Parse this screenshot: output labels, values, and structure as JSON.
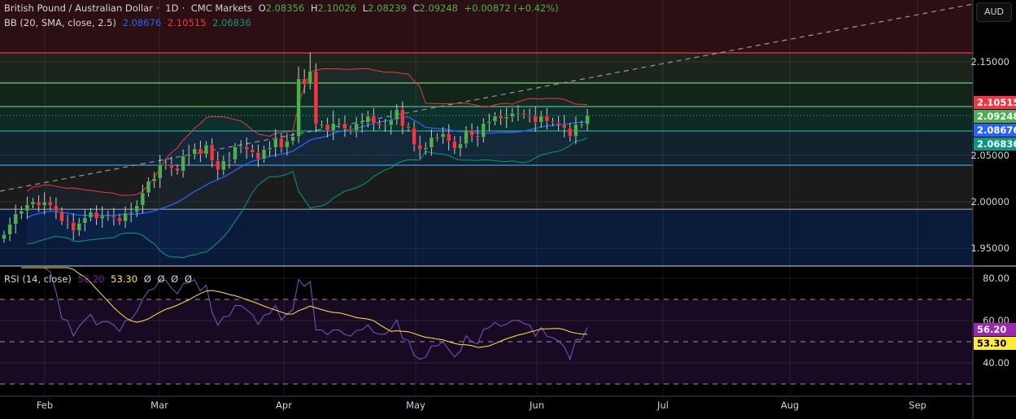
{
  "header": {
    "symbol": "British Pound / Australian Dollar",
    "interval": "1D",
    "source": "CMC Markets",
    "sep": "·",
    "o_label": "O",
    "o": "2.08356",
    "h_label": "H",
    "h": "2.10026",
    "l_label": "L",
    "l": "2.08239",
    "c_label": "C",
    "c": "2.09248",
    "change": "+0.00872 (+0.42%)"
  },
  "bb_legend": {
    "label": "BB (20, SMA, close, 2.5)",
    "basis": "2.08676",
    "upper": "2.10515",
    "lower": "2.06836"
  },
  "rsi_legend": {
    "label": "RSI (14, close)",
    "rsi": "56.20",
    "ma": "53.30",
    "extra": [
      "Ø",
      "Ø",
      "Ø",
      "Ø"
    ]
  },
  "currency": "AUD",
  "price_axis": [
    "2.15000",
    "2.05000",
    "2.00000",
    "1.95000"
  ],
  "price_tags": [
    {
      "text": "2.10515",
      "color": "#f23645"
    },
    {
      "text": "2.09248",
      "color": "#4caf50"
    },
    {
      "text": "2.08676",
      "color": "#2962ff"
    },
    {
      "text": "2.06836",
      "color": "#089981"
    }
  ],
  "rsi_axis": [
    "80.00",
    "60.00",
    "40.00"
  ],
  "rsi_tags": [
    {
      "text": "56.20",
      "color": "#9c27b0",
      "fg": "#fff"
    },
    {
      "text": "53.30",
      "color": "#ffeb3b",
      "fg": "#000"
    }
  ],
  "time_axis": [
    "Feb",
    "Mar",
    "Apr",
    "May",
    "Jun",
    "Jul",
    "Aug",
    "Sep"
  ],
  "chart_data": {
    "type": "candlestick",
    "title": "British Pound / Australian Dollar · 1D · CMC Markets",
    "ylim": [
      1.925,
      2.195
    ],
    "levels": [
      2.1596,
      2.1273,
      2.102,
      2.0759,
      2.0392,
      1.992
    ],
    "closes": [
      1.965,
      1.976,
      1.987,
      1.99,
      1.997,
      2.0,
      1.996,
      2.0,
      1.996,
      1.99,
      1.979,
      1.978,
      1.969,
      1.977,
      1.983,
      1.989,
      1.982,
      1.985,
      1.985,
      1.983,
      1.979,
      1.988,
      1.989,
      1.996,
      2.0096,
      2.022,
      2.025,
      2.04,
      2.04,
      2.036,
      2.033,
      2.049,
      2.051,
      2.057,
      2.051,
      2.061,
      2.044,
      2.034,
      2.044,
      2.045,
      2.059,
      2.059,
      2.056,
      2.053,
      2.046,
      2.056,
      2.058,
      2.068,
      2.058,
      2.065,
      2.07,
      2.132,
      2.126,
      2.14,
      2.083,
      2.083,
      2.076,
      2.084,
      2.084,
      2.078,
      2.076,
      2.084,
      2.085,
      2.092,
      2.084,
      2.082,
      2.082,
      2.088,
      2.099,
      2.081,
      2.079,
      2.061,
      2.056,
      2.058,
      2.069,
      2.069,
      2.073,
      2.065,
      2.057,
      2.062,
      2.077,
      2.071,
      2.069,
      2.084,
      2.086,
      2.092,
      2.089,
      2.091,
      2.095,
      2.095,
      2.093,
      2.092,
      2.085,
      2.092,
      2.086,
      2.085,
      2.083,
      2.079,
      2.07,
      2.083,
      2.083,
      2.09248
    ],
    "first_open": 1.96,
    "bb": {
      "length": 20,
      "mult": 2.5
    },
    "rsi": {
      "length": 14,
      "ma_length": 14,
      "ylim": [
        25,
        85
      ],
      "levels": [
        70,
        50,
        30
      ]
    },
    "colors": {
      "up": "#4caf50",
      "down": "#f23645",
      "basis": "#2962ff",
      "upper": "#f23645",
      "lower": "#089981",
      "rsi": "#7e57c2",
      "rsi_ma": "#ffeb3b"
    }
  }
}
